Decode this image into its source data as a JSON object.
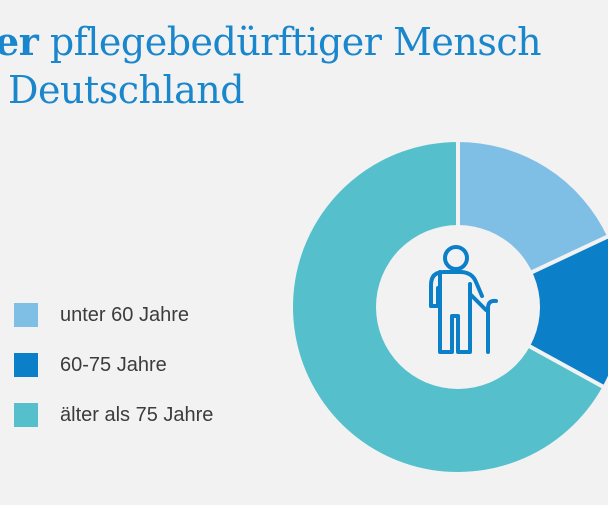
{
  "title": {
    "line1_bold": "ter",
    "line1_rest": "pflegebedürftiger Mensch",
    "line2": "Deutschland"
  },
  "chart_data": {
    "type": "pie",
    "categories": [
      "unter 60 Jahre",
      "60-75 Jahre",
      "älter als 75 Jahre"
    ],
    "values": [
      18,
      15,
      67
    ],
    "colors": [
      "#7fbfe6",
      "#0c7fc9",
      "#55c0cc"
    ],
    "legend_position": "left",
    "center_icon": "elderly-person-with-cane-icon"
  }
}
